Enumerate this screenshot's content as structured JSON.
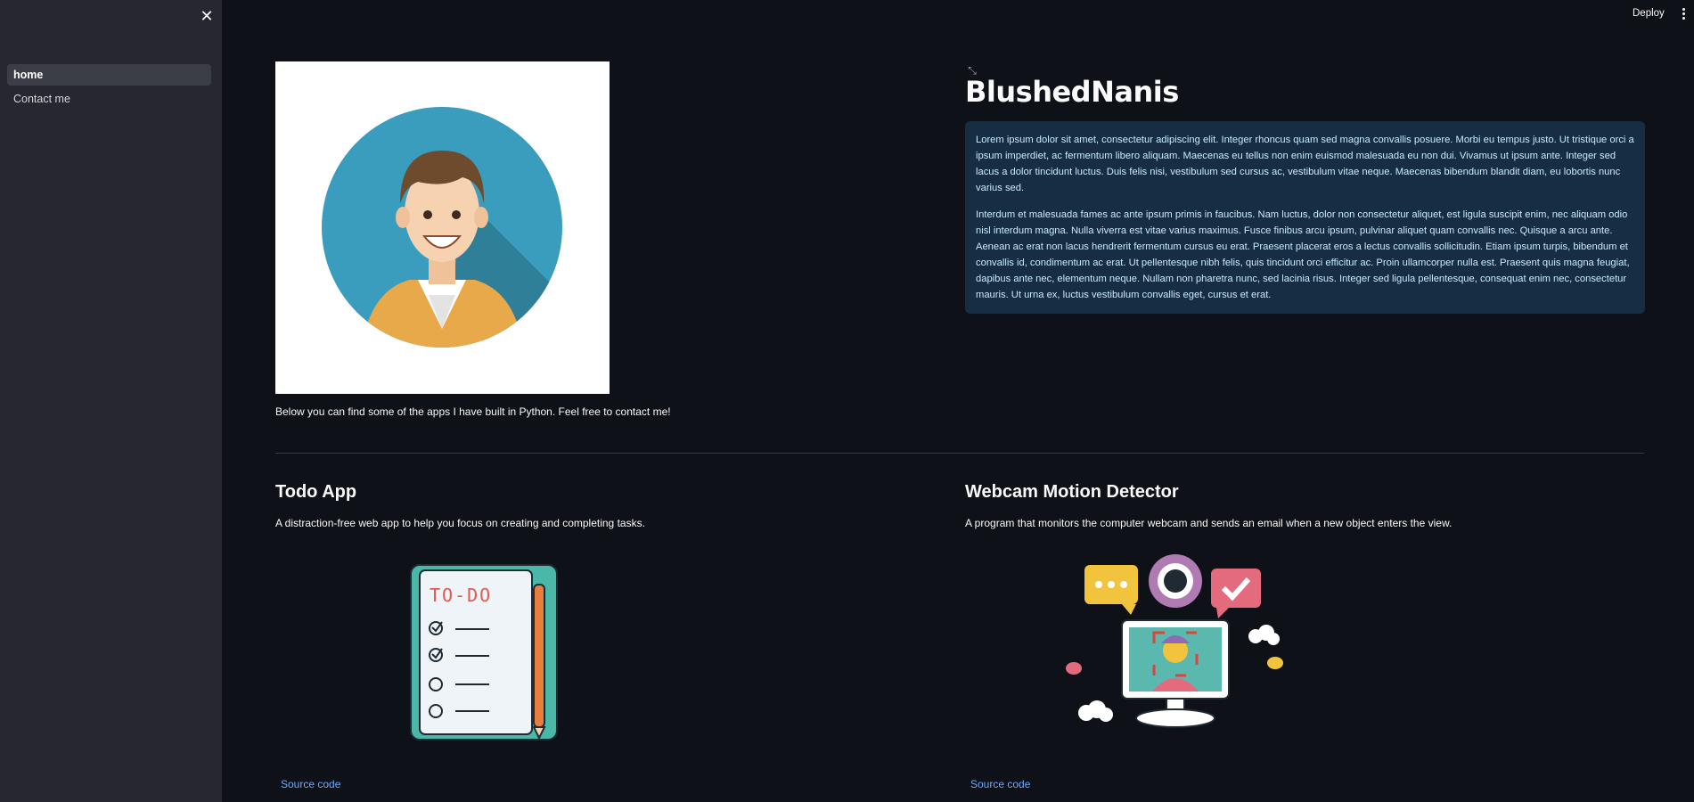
{
  "sidebar": {
    "close_icon": "close-icon",
    "items": [
      {
        "label": "home",
        "active": true
      },
      {
        "label": "Contact me",
        "active": false
      }
    ]
  },
  "topbar": {
    "deploy_label": "Deploy",
    "menu_icon": "vertical-ellipsis-icon"
  },
  "header": {
    "title": "BlushedNanis",
    "intro": "Below you can find some of the apps I have built in Python. Feel free to contact me!",
    "paragraphs": [
      "Lorem ipsum dolor sit amet, consectetur adipiscing elit. Integer rhoncus quam sed magna convallis posuere. Morbi eu tempus justo. Ut tristique orci a ipsum imperdiet, ac fermentum libero aliquam. Maecenas eu tellus non enim euismod malesuada eu non dui. Vivamus ut ipsum ante. Integer sed lacus a dolor tincidunt luctus. Duis felis nisi, vestibulum sed cursus ac, vestibulum vitae neque. Maecenas bibendum blandit diam, eu lobortis nunc varius sed.",
      "Interdum et malesuada fames ac ante ipsum primis in faucibus. Nam luctus, dolor non consectetur aliquet, est ligula suscipit enim, nec aliquam odio nisl interdum magna. Nulla viverra est vitae varius maximus. Fusce finibus arcu ipsum, pulvinar aliquet quam convallis nec. Quisque a arcu ante. Aenean ac erat non lacus hendrerit fermentum cursus eu erat. Praesent placerat eros a lectus convallis sollicitudin. Etiam ipsum turpis, bibendum et convallis id, condimentum ac erat. Ut pellentesque nibh felis, quis tincidunt orci efficitur ac. Proin ullamcorper nulla est. Praesent quis magna feugiat, dapibus ante nec, elementum neque. Nullam non pharetra nunc, sed lacinia risus. Integer sed ligula pellentesque, consequat enim nec, consectetur mauris. Ut urna ex, luctus vestibulum convallis eget, cursus et erat."
    ]
  },
  "apps": [
    {
      "title": "Todo App",
      "description": "A distraction-free web app to help you focus on creating and completing tasks.",
      "image_text": "TO-DO",
      "link": "Source code"
    },
    {
      "title": "Webcam Motion Detector",
      "description": "A program that monitors the computer webcam and sends an email when a new object enters the view.",
      "link": "Source code"
    }
  ],
  "colors": {
    "background": "#0e1117",
    "sidebar": "#262730",
    "info_bg": "#172d43",
    "info_text": "#c7ebff",
    "link": "#6fa8ff"
  }
}
